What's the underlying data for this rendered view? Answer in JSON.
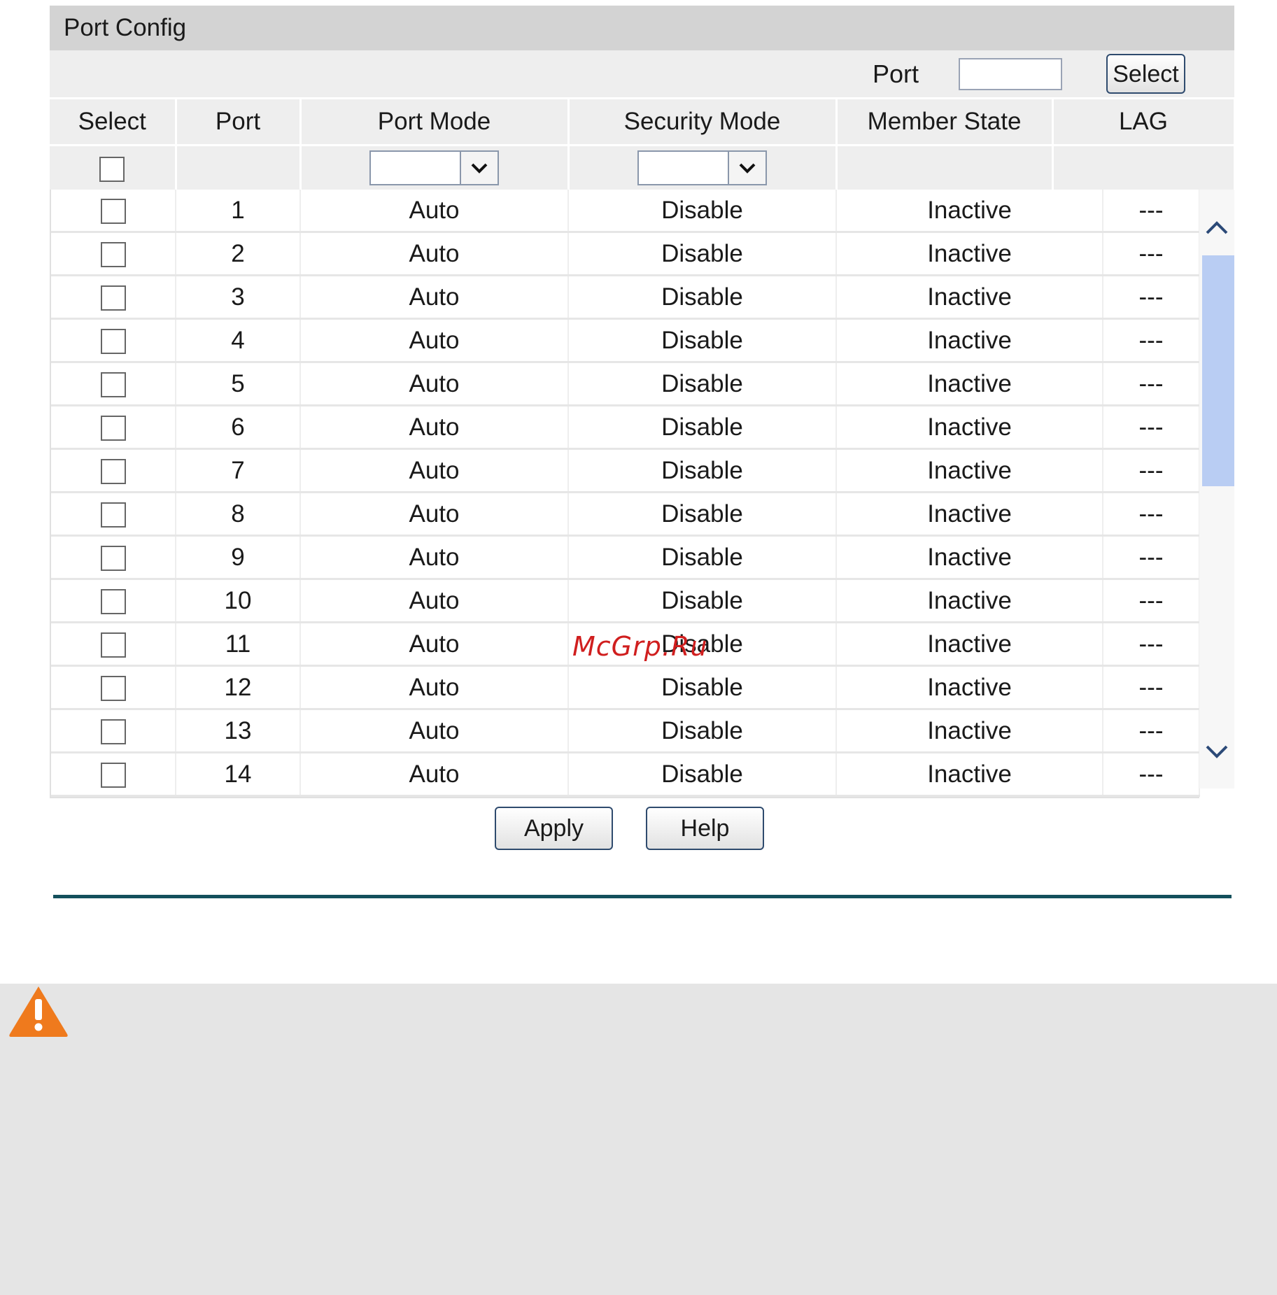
{
  "panel": {
    "title": "Port Config",
    "filter": {
      "port_label": "Port",
      "port_value": "",
      "select_label": "Select"
    }
  },
  "table": {
    "headers": [
      "Select",
      "Port",
      "Port Mode",
      "Security Mode",
      "Member State",
      "LAG"
    ],
    "filters": {
      "port_mode": "",
      "security_mode": ""
    },
    "rows": [
      {
        "port": "1",
        "port_mode": "Auto",
        "security_mode": "Disable",
        "member_state": "Inactive",
        "lag": "---"
      },
      {
        "port": "2",
        "port_mode": "Auto",
        "security_mode": "Disable",
        "member_state": "Inactive",
        "lag": "---"
      },
      {
        "port": "3",
        "port_mode": "Auto",
        "security_mode": "Disable",
        "member_state": "Inactive",
        "lag": "---"
      },
      {
        "port": "4",
        "port_mode": "Auto",
        "security_mode": "Disable",
        "member_state": "Inactive",
        "lag": "---"
      },
      {
        "port": "5",
        "port_mode": "Auto",
        "security_mode": "Disable",
        "member_state": "Inactive",
        "lag": "---"
      },
      {
        "port": "6",
        "port_mode": "Auto",
        "security_mode": "Disable",
        "member_state": "Inactive",
        "lag": "---"
      },
      {
        "port": "7",
        "port_mode": "Auto",
        "security_mode": "Disable",
        "member_state": "Inactive",
        "lag": "---"
      },
      {
        "port": "8",
        "port_mode": "Auto",
        "security_mode": "Disable",
        "member_state": "Inactive",
        "lag": "---"
      },
      {
        "port": "9",
        "port_mode": "Auto",
        "security_mode": "Disable",
        "member_state": "Inactive",
        "lag": "---"
      },
      {
        "port": "10",
        "port_mode": "Auto",
        "security_mode": "Disable",
        "member_state": "Inactive",
        "lag": "---"
      },
      {
        "port": "11",
        "port_mode": "Auto",
        "security_mode": "Disable",
        "member_state": "Inactive",
        "lag": "---"
      },
      {
        "port": "12",
        "port_mode": "Auto",
        "security_mode": "Disable",
        "member_state": "Inactive",
        "lag": "---"
      },
      {
        "port": "13",
        "port_mode": "Auto",
        "security_mode": "Disable",
        "member_state": "Inactive",
        "lag": "---"
      },
      {
        "port": "14",
        "port_mode": "Auto",
        "security_mode": "Disable",
        "member_state": "Inactive",
        "lag": "---"
      }
    ]
  },
  "actions": {
    "apply_label": "Apply",
    "help_label": "Help"
  },
  "icons": {
    "dropdown": "chevron-down-icon",
    "scroll_up": "chevron-up-icon",
    "scroll_down": "chevron-down-icon",
    "warning": "warning-triangle-icon"
  },
  "colors": {
    "header_bg": "#d3d3d3",
    "scroll_thumb": "#b9cdf3",
    "divider": "#14505c",
    "warning": "#ef7a1d",
    "watermark": "#d01e1e"
  },
  "watermark": "McGrp.Ru"
}
